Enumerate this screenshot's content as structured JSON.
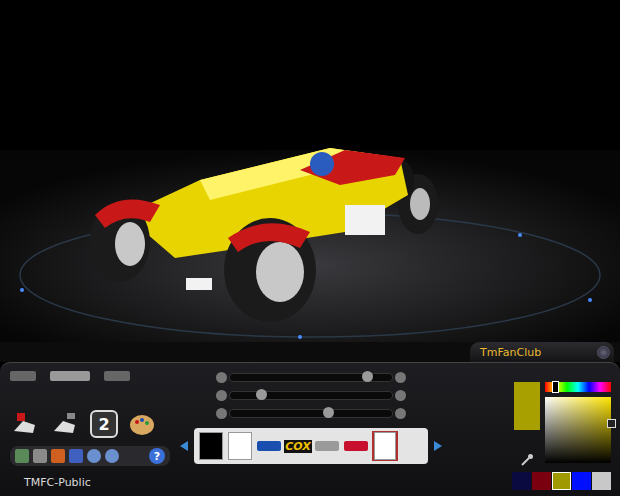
{
  "player": {
    "name": "TmFanClub"
  },
  "skin": {
    "name": "TMFC-Public"
  },
  "tools": {
    "number_badge": "2",
    "help_icon": "?"
  },
  "sliders": [
    {
      "level": 0.85
    },
    {
      "level": 0.2
    },
    {
      "level": 0.61
    }
  ],
  "decals": [
    {
      "kind": "swatch",
      "color": "#000000",
      "selected": false
    },
    {
      "kind": "swatch",
      "color": "#ffffff",
      "selected": false
    },
    {
      "kind": "logo",
      "color": "#1a4fb0",
      "selected": false
    },
    {
      "kind": "text",
      "label": "COX",
      "color": "#f0c000",
      "selected": false
    },
    {
      "kind": "logo",
      "color": "#9a9a9a",
      "selected": false
    },
    {
      "kind": "logo",
      "color": "#c8102e",
      "selected": false
    },
    {
      "kind": "swatch",
      "color": "#ffffff",
      "selected": true
    }
  ],
  "color_picker": {
    "color": "#a8a000",
    "hue": 0.15,
    "saturation": 1,
    "brightness": 0.6
  },
  "palette": [
    {
      "color": "#0a0a40",
      "selected": false
    },
    {
      "color": "#7a0010",
      "selected": false
    },
    {
      "color": "#a09a00",
      "selected": true
    },
    {
      "color": "#0010ff",
      "selected": false
    },
    {
      "color": "#c8c8c8",
      "selected": false
    }
  ]
}
